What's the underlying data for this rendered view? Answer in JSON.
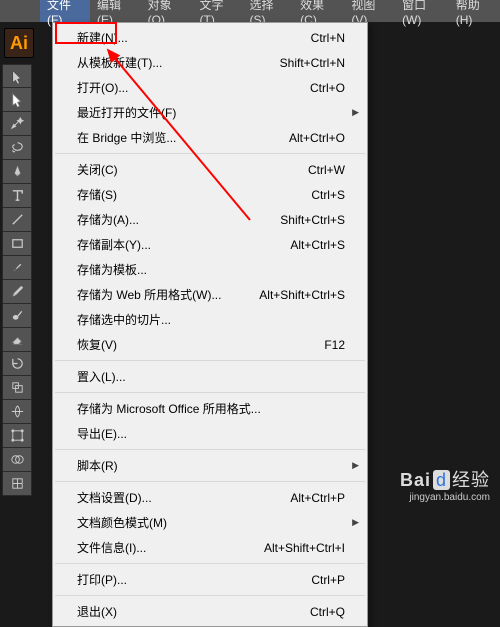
{
  "logo": "Ai",
  "menubar": {
    "items": [
      {
        "label": "文件(F)",
        "active": true
      },
      {
        "label": "编辑(E)"
      },
      {
        "label": "对象(O)"
      },
      {
        "label": "文字(T)"
      },
      {
        "label": "选择(S)"
      },
      {
        "label": "效果(C)"
      },
      {
        "label": "视图(V)"
      },
      {
        "label": "窗口(W)"
      },
      {
        "label": "帮助(H)"
      }
    ]
  },
  "dropdown": {
    "items": [
      {
        "label": "新建(N)...",
        "shortcut": "Ctrl+N",
        "highlight": true
      },
      {
        "label": "从模板新建(T)...",
        "shortcut": "Shift+Ctrl+N"
      },
      {
        "label": "打开(O)...",
        "shortcut": "Ctrl+O"
      },
      {
        "label": "最近打开的文件(F)",
        "submenu": true
      },
      {
        "label": "在 Bridge 中浏览...",
        "shortcut": "Alt+Ctrl+O"
      },
      {
        "sep": true
      },
      {
        "label": "关闭(C)",
        "shortcut": "Ctrl+W"
      },
      {
        "label": "存储(S)",
        "shortcut": "Ctrl+S"
      },
      {
        "label": "存储为(A)...",
        "shortcut": "Shift+Ctrl+S"
      },
      {
        "label": "存储副本(Y)...",
        "shortcut": "Alt+Ctrl+S"
      },
      {
        "label": "存储为模板..."
      },
      {
        "label": "存储为 Web 所用格式(W)...",
        "shortcut": "Alt+Shift+Ctrl+S"
      },
      {
        "label": "存储选中的切片..."
      },
      {
        "label": "恢复(V)",
        "shortcut": "F12"
      },
      {
        "sep": true
      },
      {
        "label": "置入(L)..."
      },
      {
        "sep": true
      },
      {
        "label": "存储为 Microsoft Office 所用格式..."
      },
      {
        "label": "导出(E)..."
      },
      {
        "sep": true
      },
      {
        "label": "脚本(R)",
        "submenu": true
      },
      {
        "sep": true
      },
      {
        "label": "文档设置(D)...",
        "shortcut": "Alt+Ctrl+P"
      },
      {
        "label": "文档颜色模式(M)",
        "submenu": true
      },
      {
        "label": "文件信息(I)...",
        "shortcut": "Alt+Shift+Ctrl+I"
      },
      {
        "sep": true
      },
      {
        "label": "打印(P)...",
        "shortcut": "Ctrl+P"
      },
      {
        "sep": true
      },
      {
        "label": "退出(X)",
        "shortcut": "Ctrl+Q"
      }
    ]
  },
  "tools": [
    "selection",
    "direct-selection",
    "wand",
    "lasso",
    "pen",
    "type",
    "line",
    "rectangle",
    "brush",
    "pencil",
    "blob",
    "eraser",
    "rotate",
    "scale",
    "width",
    "free-transform",
    "shape-builder",
    "mesh"
  ],
  "watermark": {
    "brand_a": "Bai",
    "brand_b": "d",
    "brand_c": "经验",
    "url": "jingyan.baidu.com"
  }
}
